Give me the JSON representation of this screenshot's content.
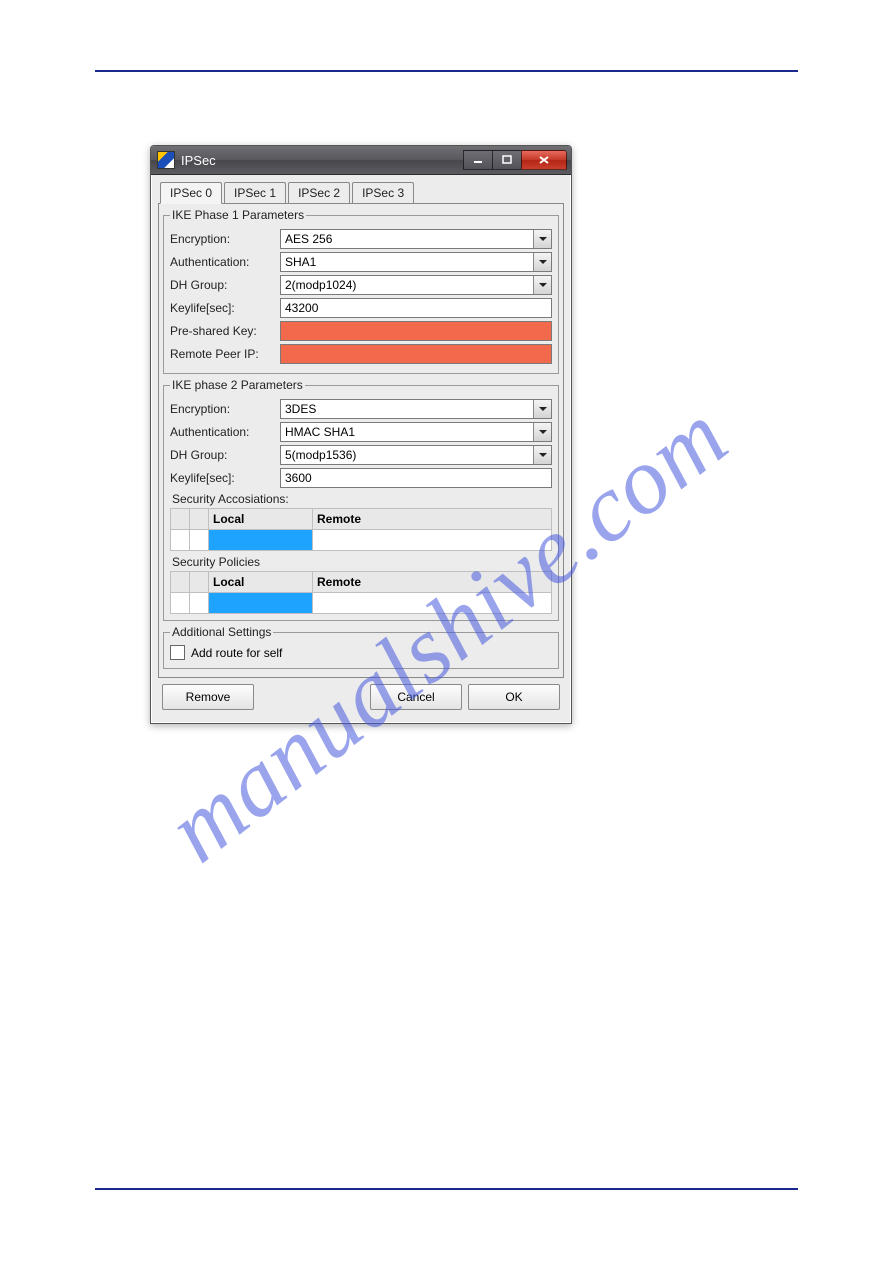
{
  "watermark": "manualshive.com",
  "window": {
    "title": "IPSec",
    "tabs": [
      "IPSec 0",
      "IPSec 1",
      "IPSec 2",
      "IPSec 3"
    ],
    "active_tab": 0,
    "phase1": {
      "legend": "IKE Phase 1 Parameters",
      "encryption_label": "Encryption:",
      "encryption_value": "AES 256",
      "auth_label": "Authentication:",
      "auth_value": "SHA1",
      "dh_label": "DH Group:",
      "dh_value": "2(modp1024)",
      "keylife_label": "Keylife[sec]:",
      "keylife_value": "43200",
      "psk_label": "Pre-shared Key:",
      "psk_value": "",
      "peer_label": "Remote Peer IP:",
      "peer_value": ""
    },
    "phase2": {
      "legend": "IKE phase 2 Parameters",
      "encryption_label": "Encryption:",
      "encryption_value": "3DES",
      "auth_label": "Authentication:",
      "auth_value": "HMAC SHA1",
      "dh_label": "DH Group:",
      "dh_value": "5(modp1536)",
      "keylife_label": "Keylife[sec]:",
      "keylife_value": "3600",
      "sa_title": "Security Accosiations:",
      "sa_columns": {
        "local": "Local",
        "remote": "Remote"
      },
      "sp_title": "Security Policies",
      "sp_columns": {
        "local": "Local",
        "remote": "Remote"
      }
    },
    "additional": {
      "legend": "Additional Settings",
      "add_route_label": "Add route for self"
    },
    "buttons": {
      "remove": "Remove",
      "cancel": "Cancel",
      "ok": "OK"
    }
  }
}
